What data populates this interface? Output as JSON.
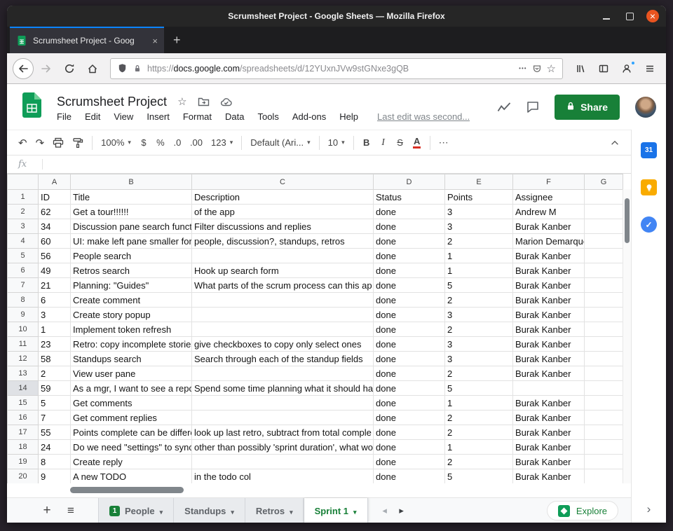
{
  "colors": {
    "share_green": "#188038",
    "logo_green": "#0f9d58",
    "close_orange": "#e95420",
    "badge_green": "#188038",
    "calendar_blue": "#1a73e8",
    "keep_yellow": "#f9ab00",
    "tasks_blue": "#4285f4"
  },
  "window": {
    "title": "Scrumsheet Project - Google Sheets — Mozilla Firefox"
  },
  "browser": {
    "tab_title": "Scrumsheet Project - Goog",
    "url_protocol": "https://",
    "url_domain": "docs.google.com",
    "url_path": "/spreadsheets/d/12YUxnJVw9stGNxe3gQB"
  },
  "sheets": {
    "doc_title": "Scrumsheet Project",
    "menus": [
      "File",
      "Edit",
      "View",
      "Insert",
      "Format",
      "Data",
      "Tools",
      "Add-ons",
      "Help"
    ],
    "last_edit": "Last edit was second...",
    "share_label": "Share",
    "toolbar": {
      "zoom": "100%",
      "currency": "$",
      "percent": "%",
      "decimal_decrease": ".0",
      "decimal_increase": ".00",
      "more_formats": "123",
      "font": "Default (Ari...",
      "font_size": "10",
      "bold": "B",
      "italic": "I",
      "strikethrough": "S",
      "text_color": "A",
      "more": "⋯"
    },
    "formula_bar_label": "fx",
    "grid": {
      "columns": [
        "A",
        "B",
        "C",
        "D",
        "E",
        "F",
        "G"
      ],
      "selected_row": 14,
      "rows": [
        [
          "ID",
          "Title",
          "Description",
          "Status",
          "Points",
          "Assignee"
        ],
        [
          "62",
          "Get a tour!!!!!!",
          "of the app",
          "done",
          "3",
          "Andrew M"
        ],
        [
          "34",
          "Discussion pane search funct",
          "Filter discussions and replies",
          "done",
          "3",
          "Burak Kanber"
        ],
        [
          "60",
          "UI: make left pane smaller for",
          "people, discussion?, standups, retros",
          "done",
          "2",
          "Marion Demarque"
        ],
        [
          "56",
          "People search",
          "",
          "done",
          "1",
          "Burak Kanber"
        ],
        [
          "49",
          "Retros search",
          "Hook up search form",
          "done",
          "1",
          "Burak Kanber"
        ],
        [
          "21",
          "Planning: \"Guides\"",
          "What parts of the scrum process can this ap",
          "done",
          "5",
          "Burak Kanber"
        ],
        [
          "6",
          "Create comment",
          "",
          "done",
          "2",
          "Burak Kanber"
        ],
        [
          "3",
          "Create story popup",
          "",
          "done",
          "3",
          "Burak Kanber"
        ],
        [
          "1",
          "Implement token refresh",
          "",
          "done",
          "2",
          "Burak Kanber"
        ],
        [
          "23",
          "Retro: copy incomplete stories",
          "give checkboxes to copy only select ones",
          "done",
          "3",
          "Burak Kanber"
        ],
        [
          "58",
          "Standups search",
          "Search through each of the standup fields",
          "done",
          "3",
          "Burak Kanber"
        ],
        [
          "2",
          "View user pane",
          "",
          "done",
          "2",
          "Burak Kanber"
        ],
        [
          "59",
          "As a mgr, I want to see a repo",
          "Spend some time planning what it should ha",
          "done",
          "5",
          ""
        ],
        [
          "5",
          "Get comments",
          "",
          "done",
          "1",
          "Burak Kanber"
        ],
        [
          "7",
          "Get comment replies",
          "",
          "done",
          "2",
          "Burak Kanber"
        ],
        [
          "55",
          "Points complete can be differe",
          "look up last retro, subtract from total comple",
          "done",
          "2",
          "Burak Kanber"
        ],
        [
          "24",
          "Do we need \"settings\" to sync",
          "other than possibly 'sprint duration', what wo",
          "done",
          "1",
          "Burak Kanber"
        ],
        [
          "8",
          "Create reply",
          "",
          "done",
          "2",
          "Burak Kanber"
        ],
        [
          "9",
          "A new TODO",
          "in the todo col",
          "done",
          "5",
          "Burak Kanber"
        ]
      ]
    },
    "sheet_tabs": [
      {
        "label": "People",
        "badge": "1"
      },
      {
        "label": "Standups"
      },
      {
        "label": "Retros"
      },
      {
        "label": "Sprint 1",
        "active": true
      }
    ],
    "explore_label": "Explore",
    "calendar_day": "31"
  }
}
